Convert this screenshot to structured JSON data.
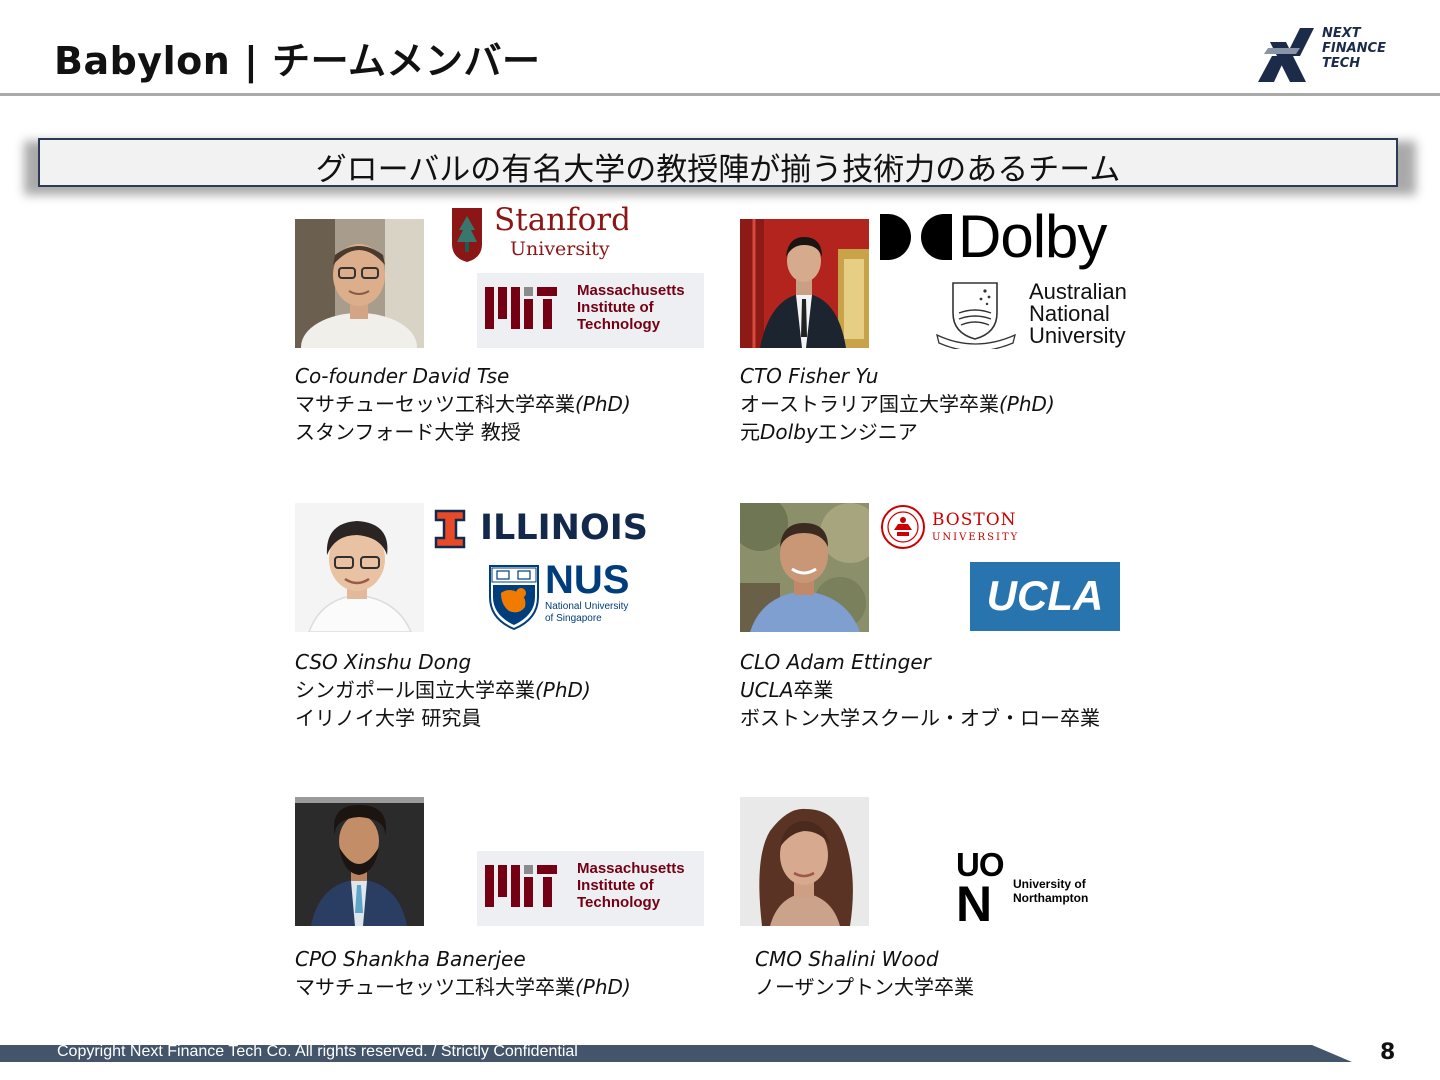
{
  "header": {
    "title": "Babylon | チームメンバー",
    "brand_lines": [
      "NEXT",
      "FINANCE",
      "TECH"
    ]
  },
  "banner": {
    "text": "グローバルの有名大学の教授陣が揃う技術力のあるチーム"
  },
  "logos": {
    "stanford": {
      "name": "Stanford",
      "sub": "University"
    },
    "mit": {
      "lines": [
        "Massachusetts",
        "Institute of",
        "Technology"
      ]
    },
    "dolby": {
      "name": "Dolby"
    },
    "anu": {
      "lines": [
        "Australian",
        "National",
        "University"
      ]
    },
    "illinois": {
      "name": "ILLINOIS"
    },
    "nus": {
      "name": "NUS",
      "lines": [
        "National University",
        "of Singapore"
      ]
    },
    "boston": {
      "lines": [
        "BOSTON",
        "UNIVERSITY"
      ]
    },
    "ucla": {
      "name": "UCLA"
    },
    "northampton": {
      "mark_top": "UO",
      "mark_bottom": "N",
      "lines": [
        "University of",
        "Northampton"
      ]
    }
  },
  "members": [
    {
      "name": "Co-founder David Tse",
      "line1": "マサチューセッツ工科大学卒業",
      "line1_suffix": "(PhD)",
      "line2": "スタンフォード大学 教授"
    },
    {
      "name": "CTO Fisher Yu",
      "line1": "オーストラリア国立大学卒業",
      "line1_suffix": "(PhD)",
      "line2_prefix": "元",
      "line2_em": "Dolby",
      "line2": "エンジニア"
    },
    {
      "name": "CSO Xinshu Dong",
      "line1": "シンガポール国立大学卒業",
      "line1_suffix": "(PhD)",
      "line2": "イリノイ大学 研究員"
    },
    {
      "name": "CLO Adam Ettinger",
      "line1_em": "UCLA",
      "line1": "卒業",
      "line2": "ボストン大学スクール・オブ・ロー卒業"
    },
    {
      "name": "CPO Shankha Banerjee",
      "line1": "マサチューセッツ工科大学卒業",
      "line1_suffix": "(PhD)"
    },
    {
      "name": "CMO Shalini Wood",
      "line1": "ノーザンプトン大学卒業"
    }
  ],
  "footer": {
    "copyright": "Copyright Next Finance Tech Co. All rights reserved. / Strictly Confidential",
    "page_number": "8"
  },
  "colors": {
    "navy": "#2d3a55",
    "footer_bar": "#44546a",
    "stanford_red": "#8c1515",
    "mit_red": "#750014",
    "illinois_orange": "#e84a27",
    "illinois_navy": "#13294b",
    "nus_blue": "#003d7c",
    "nus_orange": "#ef7c00",
    "boston_red": "#cc0000",
    "ucla_blue": "#2774ae"
  }
}
